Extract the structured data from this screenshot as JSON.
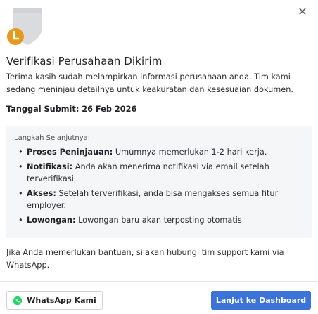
{
  "modal": {
    "close_icon": "close-icon",
    "status_icon": "shield-clock-icon",
    "title": "Verifikasi Perusahaan Dikirim",
    "description": "Terima kasih sudah melampirkan informasi perusahaan anda. Tim kami sedang meninjau detailnya untuk keakuratan dan kesesuaian dokumen.",
    "submit_date": "Tanggal Submit: 26 Feb 2026",
    "steps": {
      "heading": "Langkah Selanjutnya:",
      "items": [
        {
          "key": "Proses Peninjauan:",
          "text": " Umumnya memerlukan 1-2 hari kerja."
        },
        {
          "key": "Notifikasi:",
          "text": " Anda akan menerima notifikasi via email setelah terverifikasi."
        },
        {
          "key": "Akses:",
          "text": " Setelah terverifikasi, anda bisa mengakses semua fitur employer."
        },
        {
          "key": "Lowongan:",
          "text": " Lowongan baru akan terposting otomatis"
        }
      ]
    },
    "help_text": "Jika Anda memerlukan bantuan, silakan hubungi tim support kami via WhatsApp.",
    "whatsapp_button": "WhatsApp Kami",
    "whatsapp_icon": "whatsapp-icon",
    "primary_button": "Lanjut ke Dashboard"
  },
  "colors": {
    "primary": "#3b73d9",
    "shield": "#d9dbde",
    "clock": "#e59a1f",
    "whatsapp": "#25d366",
    "steps_bg": "#f5f6f8"
  }
}
